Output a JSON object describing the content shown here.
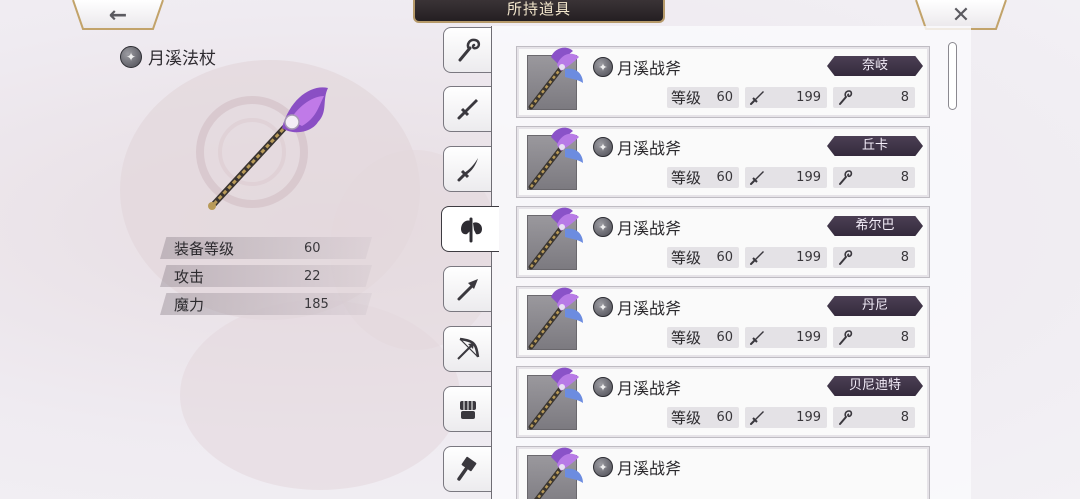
{
  "header": {
    "title": "所持道具"
  },
  "nav": {
    "back_glyph": "←",
    "close_glyph": "✕"
  },
  "selected_item": {
    "name": "月溪法杖",
    "stats": [
      {
        "label": "装备等级",
        "value": "60"
      },
      {
        "label": "攻击",
        "value": "22"
      },
      {
        "label": "魔力",
        "value": "185"
      }
    ]
  },
  "tabs": [
    {
      "icon": "staff-icon",
      "active": false
    },
    {
      "icon": "sword-icon",
      "active": false
    },
    {
      "icon": "blade-icon",
      "active": false
    },
    {
      "icon": "axe-icon",
      "active": true
    },
    {
      "icon": "spear-icon",
      "active": false
    },
    {
      "icon": "bow-icon",
      "active": false
    },
    {
      "icon": "gauntlet-icon",
      "active": false
    },
    {
      "icon": "hammer-icon",
      "active": false
    }
  ],
  "items": [
    {
      "name": "月溪战斧",
      "owner": "奈岐",
      "level_label": "等级",
      "level": "60",
      "atk": "199",
      "mag": "8"
    },
    {
      "name": "月溪战斧",
      "owner": "丘卡",
      "level_label": "等级",
      "level": "60",
      "atk": "199",
      "mag": "8"
    },
    {
      "name": "月溪战斧",
      "owner": "希尔巴",
      "level_label": "等级",
      "level": "60",
      "atk": "199",
      "mag": "8"
    },
    {
      "name": "月溪战斧",
      "owner": "丹尼",
      "level_label": "等级",
      "level": "60",
      "atk": "199",
      "mag": "8"
    },
    {
      "name": "月溪战斧",
      "owner": "贝尼迪特",
      "level_label": "等级",
      "level": "60",
      "atk": "199",
      "mag": "8"
    },
    {
      "name": "月溪战斧"
    }
  ],
  "colors": {
    "accent_gold": "#c2a36a",
    "owner_tag": "#3e3347",
    "header_bg": "#2b2528"
  }
}
